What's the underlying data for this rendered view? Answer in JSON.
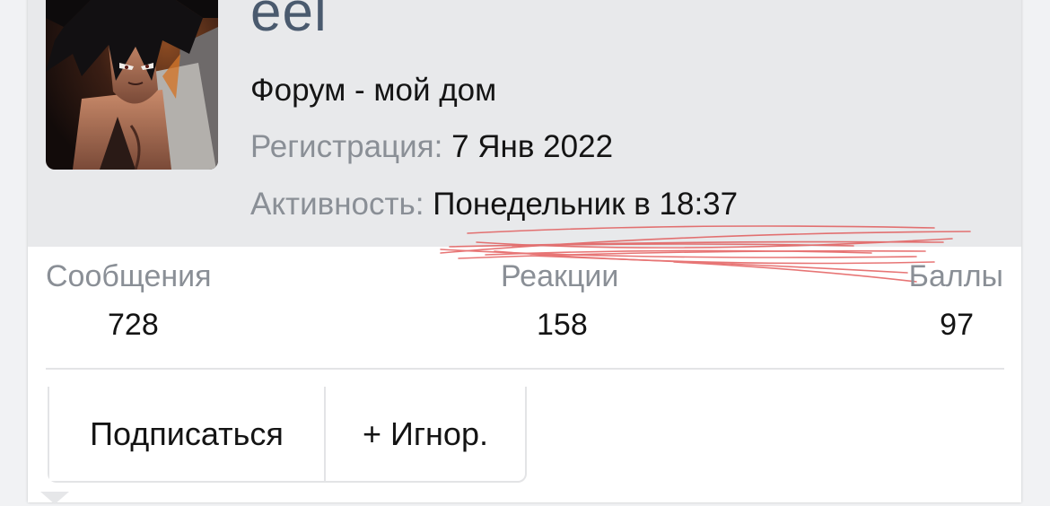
{
  "profile": {
    "username": "eel",
    "user_title": "Форум - мой дом",
    "registration_label": "Регистрация:",
    "registration_value": "7 Янв 2022",
    "activity_label": "Активность:",
    "activity_value": "Понедельник в 18:37"
  },
  "stats": {
    "messages_label": "Сообщения",
    "messages_value": "728",
    "reactions_label": "Реакции",
    "reactions_value": "158",
    "points_label": "Баллы",
    "points_value": "97"
  },
  "actions": {
    "follow_label": "Подписаться",
    "ignore_label": "+ Игнор."
  },
  "colors": {
    "header_bg": "#e8e9eb",
    "username": "#4a5a6e",
    "muted_label": "#8a8f96",
    "scribble": "#e04848"
  }
}
